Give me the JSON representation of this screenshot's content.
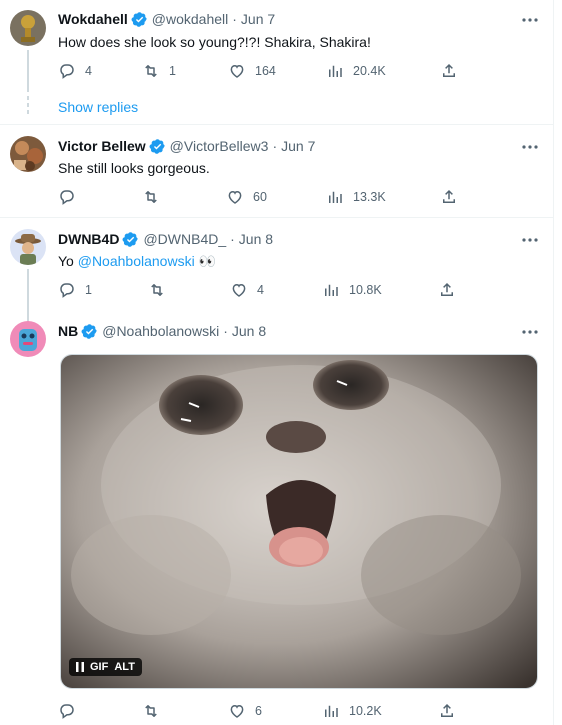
{
  "colors": {
    "accent": "#1d9bf0",
    "muted": "#536471",
    "text": "#0f1419",
    "divider": "#eff3f4"
  },
  "replies_link": "Show replies",
  "tweets": [
    {
      "name": "Wokdahell",
      "verified": true,
      "handle": "@wokdahell",
      "sep": "·",
      "date": "Jun 7",
      "text": "How does she look so young?!?!  Shakira, Shakira!",
      "reply_count": "4",
      "retweet_count": "1",
      "like_count": "164",
      "view_count": "20.4K"
    },
    {
      "name": "Victor Bellew",
      "verified": true,
      "handle": "@VictorBellew3",
      "sep": "·",
      "date": "Jun 7",
      "text": "She still looks gorgeous.",
      "reply_count": "",
      "retweet_count": "",
      "like_count": "60",
      "view_count": "13.3K"
    },
    {
      "name": "DWNB4D",
      "verified": true,
      "handle": "@DWNB4D_",
      "sep": "·",
      "date": "Jun 8",
      "text_prefix": "Yo ",
      "mention": "@Noahbolanowski",
      "text_suffix": " 👀",
      "reply_count": "1",
      "retweet_count": "",
      "like_count": "4",
      "view_count": "10.8K"
    },
    {
      "name": "NB",
      "verified": true,
      "handle": "@Noahbolanowski",
      "sep": "·",
      "date": "Jun 8",
      "media": {
        "type": "gif",
        "gif_label": "GIF",
        "alt_label": "ALT"
      },
      "reply_count": "",
      "retweet_count": "",
      "like_count": "6",
      "view_count": "10.2K"
    }
  ]
}
